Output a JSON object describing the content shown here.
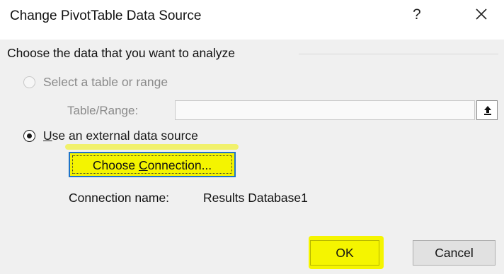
{
  "dialog": {
    "title": "Change PivotTable Data Source",
    "help_label": "?",
    "close_icon": "close-icon"
  },
  "group": {
    "label": "Choose the data that you want to analyze"
  },
  "option_range": {
    "label": "Select a table or range",
    "selected": false,
    "enabled": false,
    "field_label": "Table/Range:",
    "field_value": "",
    "collapse_icon": "upload-arrow-icon"
  },
  "option_external": {
    "label_underlined": "U",
    "label_rest": "se an external data source",
    "selected": true,
    "choose_button_pre": "Choose ",
    "choose_button_underlined": "C",
    "choose_button_post": "onnection...",
    "connection_name_label": "Connection name:",
    "connection_name_value": "Results Database1"
  },
  "buttons": {
    "ok": "OK",
    "cancel": "Cancel"
  },
  "colors": {
    "highlight": "#f5f500",
    "focus_border": "#1e73c8",
    "dialog_bg": "#f0f0f0"
  }
}
